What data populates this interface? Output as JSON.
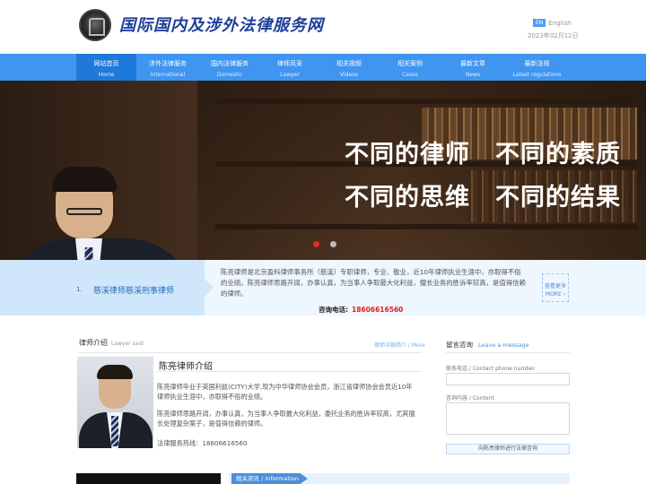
{
  "header": {
    "site_title": "国际国内及涉外法律服务网",
    "lang_badge": "EN",
    "lang_label": "English",
    "date": "2023年02月12日"
  },
  "nav": [
    {
      "zh": "网站首页",
      "en": "Home",
      "active": true
    },
    {
      "zh": "涉外法律服务",
      "en": "International"
    },
    {
      "zh": "国内法律服务",
      "en": "Domestic"
    },
    {
      "zh": "律师风采",
      "en": "Lawyer"
    },
    {
      "zh": "相关视频",
      "en": "Videos"
    },
    {
      "zh": "相关案例",
      "en": "Cases"
    },
    {
      "zh": "最新文章",
      "en": "News"
    },
    {
      "zh": "最新法规",
      "en": "Latest regulations"
    }
  ],
  "banner": {
    "line1": "不同的律师　不同的素质",
    "line2": "不同的思维　不同的结果",
    "slides": 2,
    "active_slide": 1
  },
  "intro": {
    "index": "1.",
    "tab_label": "慈溪律师慈溪刑事律师",
    "text": "陈亮律师是北京盈科律师事务所（慈溪）专职律师，专业、敬业，近10年律师执业生涯中，亦取得不俗的业绩。陈亮律师思路开阔，办事认真，为当事人争取最大化利益，擅长业务的胜诉率较高，是值得信赖的律师。",
    "phone_label": "咨询电话:",
    "phone": "18606616560",
    "more_zh": "查看更多",
    "more_en": "MORE ›"
  },
  "lawyer_section": {
    "title": "律师介绍",
    "title_en": "Lawyer said",
    "more": "律师详细简介 / More",
    "name_title": "陈亮律师介绍",
    "bio1": "陈亮律师毕业于英国利兹(CITY)大学,现为中华律师协会会员，浙江省律师协会会员近10年律师执业生涯中，亦取得不俗的业绩。",
    "bio2": "陈亮律师思路开阔，办事认真，为当事人争取最大化利益，委托业务的胜诉率较高，尤其擅长处理复杂案子，是值得信赖的律师。",
    "hotline": "法律服务热线：18606616560"
  },
  "message": {
    "title": "留言咨询",
    "title_en": "Leave a message",
    "phone_label": "联系电话 / Contact phone number",
    "content_label": "咨询内容 / Content",
    "submit": "向陈亮律师进行法律咨询"
  },
  "bottom": {
    "info_tag": "相关资讯 / Information"
  },
  "colors": {
    "nav_bg": "#3f95f0",
    "nav_active": "#1f79d8",
    "accent_red": "#e31b23"
  }
}
